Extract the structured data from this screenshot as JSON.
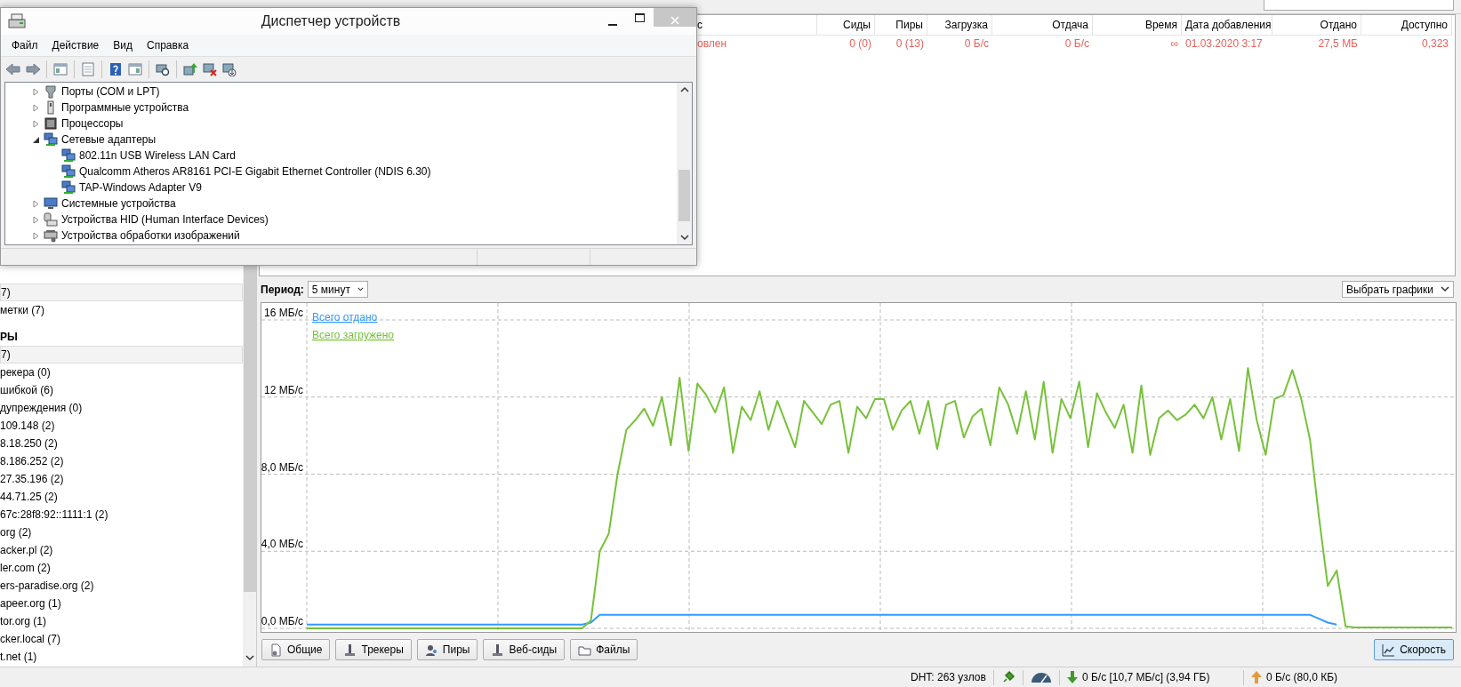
{
  "device_manager": {
    "title": "Диспетчер устройств",
    "menu": [
      "Файл",
      "Действие",
      "Вид",
      "Справка"
    ],
    "tree": [
      {
        "label": "Порты (COM и LPT)",
        "expanded": false
      },
      {
        "label": "Программные устройства",
        "expanded": false
      },
      {
        "label": "Процессоры",
        "expanded": false
      },
      {
        "label": "Сетевые адаптеры",
        "expanded": true,
        "children": [
          {
            "label": "802.11n USB Wireless LAN Card"
          },
          {
            "label": "Qualcomm Atheros AR8161 PCI-E Gigabit Ethernet Controller (NDIS 6.30)"
          },
          {
            "label": "TAP-Windows Adapter V9"
          }
        ]
      },
      {
        "label": "Системные устройства",
        "expanded": false
      },
      {
        "label": "Устройства HID (Human Interface Devices)",
        "expanded": false
      },
      {
        "label": "Устройства обработки изображений",
        "expanded": false
      }
    ]
  },
  "torrent_table": {
    "columns": [
      "с",
      "Сиды",
      "Пиры",
      "Загрузка",
      "Отдача",
      "Время",
      "Дата добавления",
      "Отдано",
      "Доступно"
    ],
    "rows": [
      [
        "овлен",
        "0 (0)",
        "0 (13)",
        "0 Б/с",
        "0 Б/с",
        "∞",
        "01.03.2020 3:17",
        "27,5 МБ",
        "0,323"
      ]
    ]
  },
  "sidebar": {
    "groups": [
      {
        "items": [
          {
            "label": "7)",
            "selected": true
          },
          {
            "label": "метки (7)",
            "selected": false
          }
        ]
      },
      {
        "title": "РЫ",
        "items": [
          {
            "label": "7)",
            "selected": true
          },
          {
            "label": "рекера (0)",
            "selected": false
          },
          {
            "label": "шибкой (6)",
            "selected": false
          },
          {
            "label": "дупреждения (0)",
            "selected": false
          },
          {
            "label": "109.148 (2)",
            "selected": false
          },
          {
            "label": "8.18.250 (2)",
            "selected": false
          },
          {
            "label": "8.186.252 (2)",
            "selected": false
          },
          {
            "label": "27.35.196 (2)",
            "selected": false
          },
          {
            "label": "44.71.25 (2)",
            "selected": false
          },
          {
            "label": "67c:28f8:92::1111:1 (2)",
            "selected": false
          },
          {
            "label": "org (2)",
            "selected": false
          },
          {
            "label": "acker.pl (2)",
            "selected": false
          },
          {
            "label": "ler.com (2)",
            "selected": false
          },
          {
            "label": "ers-paradise.org (2)",
            "selected": false
          },
          {
            "label": "apeer.org (1)",
            "selected": false
          },
          {
            "label": "tor.org (1)",
            "selected": false
          },
          {
            "label": "cker.local (7)",
            "selected": false
          },
          {
            "label": "t.net (1)",
            "selected": false
          }
        ]
      }
    ]
  },
  "graph": {
    "period_label": "Период:",
    "period": "5 минут",
    "select_graphs": "Выбрать графики",
    "chart_data": {
      "type": "line",
      "grid": true,
      "ylim": [
        0,
        16
      ],
      "yticks": [
        {
          "value": 0,
          "label": "0,0 МБ/с"
        },
        {
          "value": 4,
          "label": "4,0 МБ/с"
        },
        {
          "value": 8,
          "label": "8,0 МБ/с"
        },
        {
          "value": 12,
          "label": "12 МБ/с"
        },
        {
          "value": 16,
          "label": "16 МБ/с"
        }
      ],
      "series": [
        {
          "name": "Всего отдано",
          "color": "#3399ff",
          "values": [
            0.2,
            0.2,
            0.2,
            0.2,
            0.2,
            0.2,
            0.2,
            0.2,
            0.2,
            0.2,
            0.2,
            0.2,
            0.2,
            0.2,
            0.2,
            0.2,
            0.2,
            0.2,
            0.2,
            0.2,
            0.2,
            0.2,
            0.2,
            0.2,
            0.2,
            0.2,
            0.2,
            0.2,
            0.2,
            0.2,
            0.2,
            0.2,
            0.3,
            0.7,
            0.7,
            0.7,
            0.7,
            0.7,
            0.7,
            0.7,
            0.7,
            0.7,
            0.7,
            0.7,
            0.7,
            0.7,
            0.7,
            0.7,
            0.7,
            0.7,
            0.7,
            0.7,
            0.7,
            0.7,
            0.7,
            0.7,
            0.7,
            0.7,
            0.7,
            0.7,
            0.7,
            0.7,
            0.7,
            0.7,
            0.7,
            0.7,
            0.7,
            0.7,
            0.7,
            0.7,
            0.7,
            0.7,
            0.7,
            0.7,
            0.7,
            0.7,
            0.7,
            0.7,
            0.7,
            0.7,
            0.7,
            0.7,
            0.7,
            0.7,
            0.7,
            0.7,
            0.7,
            0.7,
            0.7,
            0.7,
            0.7,
            0.7,
            0.7,
            0.7,
            0.7,
            0.7,
            0.7,
            0.7,
            0.7,
            0.7,
            0.7,
            0.7,
            0.7,
            0.7,
            0.7,
            0.7,
            0.7,
            0.7,
            0.7,
            0.7,
            0.7,
            0.7,
            0.7,
            0.7,
            0.5,
            0.3,
            0.2,
            null,
            null,
            null,
            null,
            null,
            null,
            null,
            null,
            null,
            null,
            null,
            null,
            null
          ]
        },
        {
          "name": "Всего загружено",
          "color": "#77c13a",
          "values": [
            0,
            0,
            0,
            0,
            0,
            0,
            0,
            0,
            0,
            0,
            0,
            0,
            0,
            0,
            0,
            0,
            0,
            0,
            0,
            0,
            0,
            0,
            0,
            0,
            0,
            0,
            0,
            0,
            0,
            0,
            0,
            0,
            0.4,
            4,
            4.9,
            8,
            10.3,
            10.8,
            11.4,
            10.5,
            12,
            9.5,
            13,
            9.2,
            12.7,
            12.1,
            11.2,
            12.5,
            9.1,
            11.5,
            10.8,
            12.3,
            10.3,
            11.8,
            10.6,
            9.4,
            11.8,
            11.2,
            10.6,
            11.6,
            11.8,
            9.1,
            11.5,
            10.9,
            11.9,
            11.9,
            10.3,
            11.3,
            11.8,
            10.1,
            11.8,
            9.3,
            11.6,
            11.8,
            9.9,
            11,
            11.4,
            9.5,
            12.5,
            11.6,
            10.1,
            12.3,
            9.8,
            12.8,
            9.1,
            11.9,
            10.9,
            12.8,
            9.4,
            12.2,
            11.2,
            10.4,
            11.6,
            9.1,
            12.6,
            9,
            10.9,
            11.3,
            10.8,
            11.1,
            11.6,
            10.9,
            12,
            9.8,
            11.9,
            9.2,
            13.5,
            10.8,
            9,
            11.9,
            12.1,
            13.4,
            11.9,
            9.8,
            5.8,
            2.2,
            3,
            0.1,
            0.05,
            0.05,
            0.05,
            0.05,
            0.05,
            0.05,
            0.05,
            0.05,
            0.05,
            0.05,
            0.05,
            0.05
          ]
        }
      ]
    }
  },
  "detail_tabs": [
    {
      "label": "Общие",
      "selected": false
    },
    {
      "label": "Трекеры",
      "selected": false
    },
    {
      "label": "Пиры",
      "selected": false
    },
    {
      "label": "Веб-сиды",
      "selected": false
    },
    {
      "label": "Файлы",
      "selected": false
    },
    {
      "label": "Скорость",
      "selected": true
    }
  ],
  "status_bar": {
    "dht": "DHT: 263 узлов",
    "download": "0 Б/с [10,7 МБ/с] (3,94 ГБ)",
    "upload": "0 Б/с (80,0 КБ)"
  }
}
